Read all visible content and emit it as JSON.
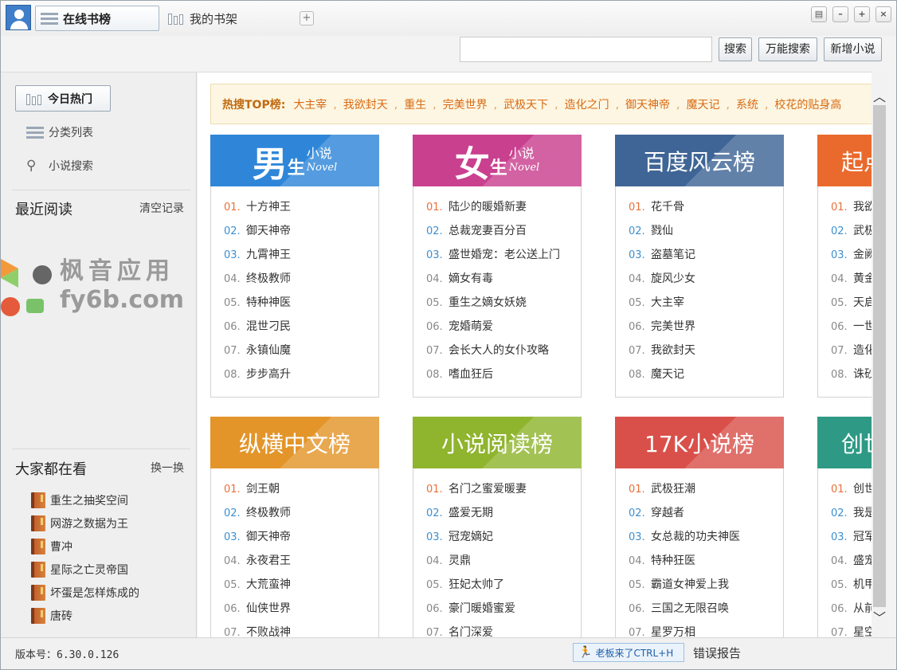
{
  "titlebar": {
    "tab_online": "在线书榜",
    "tab_shelf": "我的书架",
    "add_tab_glyph": "+"
  },
  "search": {
    "placeholder": "",
    "btn_search": "搜索",
    "btn_universal": "万能搜索",
    "btn_add_novel": "新增小说"
  },
  "sidebar": {
    "nav_today": "今日热门",
    "nav_category": "分类列表",
    "nav_search": "小说搜索",
    "recent_title": "最近阅读",
    "recent_clear": "清空记录",
    "watermark_line1": "枫音应用",
    "watermark_line2": "fy6b.com",
    "popular_title": "大家都在看",
    "popular_refresh": "换一换",
    "popular_items": [
      "重生之抽奖空间",
      "网游之数据为王",
      "曹冲",
      "星际之亡灵帝国",
      "坏蛋是怎样炼成的",
      "唐砖"
    ]
  },
  "hotbar": {
    "label": "热搜TOP榜:",
    "items": [
      "大主宰",
      "我欲封天",
      "重生",
      "完美世界",
      "武极天下",
      "造化之门",
      "御天神帝",
      "魔天记",
      "系统",
      "校花的贴身高"
    ]
  },
  "cards": [
    {
      "banner_big": "男",
      "banner_mid": "生",
      "banner_small": "小说",
      "banner_en": "Novel",
      "color": "#2f86d8",
      "items": [
        [
          "01.",
          "十方神王"
        ],
        [
          "02.",
          "御天神帝"
        ],
        [
          "03.",
          "九霄神王"
        ],
        [
          "04.",
          "终极教师"
        ],
        [
          "05.",
          "特种神医"
        ],
        [
          "06.",
          "混世刁民"
        ],
        [
          "07.",
          "永镇仙魔"
        ],
        [
          "08.",
          "步步高升"
        ]
      ]
    },
    {
      "banner_big": "女",
      "banner_mid": "生",
      "banner_small": "小说",
      "banner_en": "Novel",
      "color": "#c9408f",
      "items": [
        [
          "01.",
          "陆少的暖婚新妻"
        ],
        [
          "02.",
          "总裁宠妻百分百"
        ],
        [
          "03.",
          "盛世婚宠：老公送上门"
        ],
        [
          "04.",
          "嫡女有毒"
        ],
        [
          "05.",
          "重生之嫡女妖娆"
        ],
        [
          "06.",
          "宠婚萌爱"
        ],
        [
          "07.",
          "会长大人的女仆攻略"
        ],
        [
          "08.",
          "嗜血狂后"
        ]
      ]
    },
    {
      "banner_title": "百度风云榜",
      "color": "#3f6596",
      "items": [
        [
          "01.",
          "花千骨"
        ],
        [
          "02.",
          "戮仙"
        ],
        [
          "03.",
          "盗墓笔记"
        ],
        [
          "04.",
          "旋风少女"
        ],
        [
          "05.",
          "大主宰"
        ],
        [
          "06.",
          "完美世界"
        ],
        [
          "07.",
          "我欲封天"
        ],
        [
          "08.",
          "魔天记"
        ]
      ]
    },
    {
      "banner_title": "起点",
      "color": "#e96a2c",
      "items": [
        [
          "01.",
          "我欲"
        ],
        [
          "02.",
          "武极"
        ],
        [
          "03.",
          "金阙"
        ],
        [
          "04.",
          "黄金"
        ],
        [
          "05.",
          "天启"
        ],
        [
          "06.",
          "一世"
        ],
        [
          "07.",
          "造化"
        ],
        [
          "08.",
          "诛砂"
        ]
      ]
    },
    {
      "banner_title": "纵横中文榜",
      "color": "#e3952a",
      "items": [
        [
          "01.",
          "剑王朝"
        ],
        [
          "02.",
          "终极教师"
        ],
        [
          "03.",
          "御天神帝"
        ],
        [
          "04.",
          "永夜君王"
        ],
        [
          "05.",
          "大荒蛮神"
        ],
        [
          "06.",
          "仙侠世界"
        ],
        [
          "07.",
          "不败战神"
        ]
      ]
    },
    {
      "banner_title": "小说阅读榜",
      "color": "#8fb42e",
      "items": [
        [
          "01.",
          "名门之蜜爱暖妻"
        ],
        [
          "02.",
          "盛爱无期"
        ],
        [
          "03.",
          "冠宠嫡妃"
        ],
        [
          "04.",
          "灵鼎"
        ],
        [
          "05.",
          "狂妃太帅了"
        ],
        [
          "06.",
          "豪门暖婚蜜爱"
        ],
        [
          "07.",
          "名门深爱"
        ]
      ]
    },
    {
      "banner_title": "17K小说榜",
      "color": "#d9504a",
      "items": [
        [
          "01.",
          "武极狂潮"
        ],
        [
          "02.",
          "穿越者"
        ],
        [
          "03.",
          "女总裁的功夫神医"
        ],
        [
          "04.",
          "特种狂医"
        ],
        [
          "05.",
          "霸道女神爱上我"
        ],
        [
          "06.",
          "三国之无限召唤"
        ],
        [
          "07.",
          "星罗万相"
        ]
      ]
    },
    {
      "banner_title": "创世",
      "color": "#2e9a85",
      "items": [
        [
          "01.",
          "创世"
        ],
        [
          "02.",
          "我是"
        ],
        [
          "03.",
          "冠军"
        ],
        [
          "04.",
          "盛宠"
        ],
        [
          "05.",
          "机甲"
        ],
        [
          "06.",
          "从前"
        ],
        [
          "07.",
          "星空"
        ]
      ]
    }
  ],
  "status": {
    "version": "版本号：6.30.0.126",
    "boss_key": "老板来了CTRL+H",
    "error_report": "错误报告"
  }
}
